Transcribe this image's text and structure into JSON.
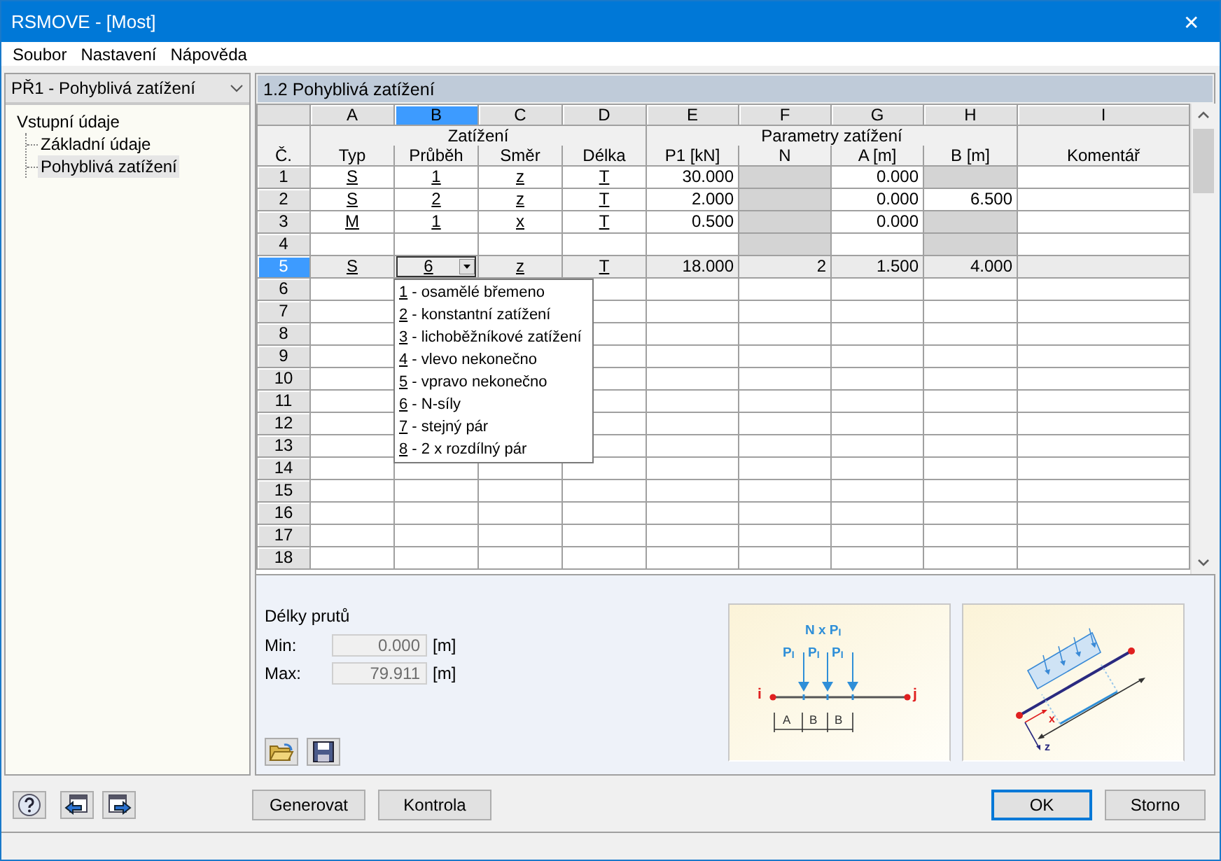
{
  "window": {
    "title": "RSMOVE - [Most]",
    "close": "✕"
  },
  "menu": [
    {
      "label": "Soubor"
    },
    {
      "label": "Nastavení"
    },
    {
      "label": "Nápověda"
    }
  ],
  "sidebar": {
    "case_select": "PŘ1 - Pohyblivá zatížení",
    "tree": [
      {
        "label": "Vstupní údaje",
        "selected": false,
        "children": [
          {
            "label": "Základní údaje",
            "selected": false
          },
          {
            "label": "Pohyblivá zatížení",
            "selected": true
          }
        ]
      }
    ]
  },
  "panel": {
    "title": "1.2 Pohyblivá zatížení",
    "table": {
      "number_header": "Č.",
      "columns": [
        {
          "letter": "A",
          "selected": false,
          "kind": "choice"
        },
        {
          "letter": "B",
          "selected": true,
          "kind": "choice"
        },
        {
          "letter": "C",
          "selected": false,
          "kind": "choice"
        },
        {
          "letter": "D",
          "selected": false,
          "kind": "choice"
        },
        {
          "letter": "E",
          "selected": false,
          "kind": "number"
        },
        {
          "letter": "F",
          "selected": false,
          "kind": "number"
        },
        {
          "letter": "G",
          "selected": false,
          "kind": "number"
        },
        {
          "letter": "H",
          "selected": false,
          "kind": "number"
        },
        {
          "letter": "I",
          "selected": false,
          "kind": "text"
        }
      ],
      "groups": [
        "Zatížení",
        "Parametry zatížení"
      ],
      "names": [
        "Typ",
        "Průběh",
        "Směr",
        "Délka",
        "P1 [kN]",
        "N",
        "A [m]",
        "B [m]",
        "Komentář"
      ],
      "rows": [
        {
          "number": "1",
          "selected": false,
          "cells": [
            {
              "value": "S",
              "disabled": false
            },
            {
              "value": "1",
              "disabled": false
            },
            {
              "value": "z",
              "disabled": false
            },
            {
              "value": "T",
              "disabled": false
            },
            {
              "value": "30.000",
              "disabled": false
            },
            {
              "disabled": true
            },
            {
              "value": "0.000",
              "disabled": false
            },
            {
              "disabled": true
            },
            {
              "disabled": false
            }
          ]
        },
        {
          "number": "2",
          "selected": false,
          "cells": [
            {
              "value": "S",
              "disabled": false
            },
            {
              "value": "2",
              "disabled": false
            },
            {
              "value": "z",
              "disabled": false
            },
            {
              "value": "T",
              "disabled": false
            },
            {
              "value": "2.000",
              "disabled": false
            },
            {
              "disabled": true
            },
            {
              "value": "0.000",
              "disabled": false
            },
            {
              "value": "6.500",
              "disabled": false
            },
            {
              "disabled": false
            }
          ]
        },
        {
          "number": "3",
          "selected": false,
          "cells": [
            {
              "value": "M",
              "disabled": false
            },
            {
              "value": "1",
              "disabled": false
            },
            {
              "value": "x",
              "disabled": false
            },
            {
              "value": "T",
              "disabled": false
            },
            {
              "value": "0.500",
              "disabled": false
            },
            {
              "disabled": true
            },
            {
              "value": "0.000",
              "disabled": false
            },
            {
              "disabled": true
            },
            {
              "disabled": false
            }
          ]
        },
        {
          "number": "4",
          "selected": false,
          "cells": [
            {
              "disabled": false
            },
            {
              "disabled": false
            },
            {
              "disabled": false
            },
            {
              "disabled": false
            },
            {
              "disabled": false
            },
            {
              "disabled": true
            },
            {
              "disabled": false
            },
            {
              "disabled": true
            },
            {
              "disabled": false
            }
          ]
        },
        {
          "number": "5",
          "selected": true,
          "cells": [
            {
              "value": "S",
              "disabled": false
            },
            {
              "value": "6",
              "disabled": false,
              "kind": "combo",
              "options": [
                {
                  "key": "1",
                  "text": " - osamělé břemeno"
                },
                {
                  "key": "2",
                  "text": " - konstantní zatížení"
                },
                {
                  "key": "3",
                  "text": " - lichoběžníkové zatížení"
                },
                {
                  "key": "4",
                  "text": " - vlevo nekonečno"
                },
                {
                  "key": "5",
                  "text": " - vpravo nekonečno"
                },
                {
                  "key": "6",
                  "text": " - N-síly"
                },
                {
                  "key": "7",
                  "text": " - stejný pár"
                },
                {
                  "key": "8",
                  "text": " - 2 x rozdílný pár"
                }
              ]
            },
            {
              "value": "z",
              "disabled": false
            },
            {
              "value": "T",
              "disabled": false
            },
            {
              "value": "18.000",
              "disabled": false
            },
            {
              "value": "2",
              "disabled": false
            },
            {
              "value": "1.500",
              "disabled": false
            },
            {
              "value": "4.000",
              "disabled": false
            },
            {
              "disabled": false
            }
          ]
        },
        {
          "number": "6",
          "selected": false
        },
        {
          "number": "7",
          "selected": false
        },
        {
          "number": "8",
          "selected": false
        },
        {
          "number": "9",
          "selected": false
        },
        {
          "number": "10",
          "selected": false
        },
        {
          "number": "11",
          "selected": false
        },
        {
          "number": "12",
          "selected": false
        },
        {
          "number": "13",
          "selected": false
        },
        {
          "number": "14",
          "selected": false
        },
        {
          "number": "15",
          "selected": false
        },
        {
          "number": "16",
          "selected": false
        },
        {
          "number": "17",
          "selected": false
        },
        {
          "number": "18",
          "selected": false
        }
      ]
    },
    "lengths": {
      "title": "Délky prutů",
      "fields": [
        {
          "label": "Min:",
          "value": "0.000",
          "unit": "[m]",
          "disabled": true
        },
        {
          "label": "Max:",
          "value": "79.911",
          "unit": "[m]",
          "disabled": true
        }
      ]
    },
    "diagrams": [
      {
        "kind": "point-loads",
        "labels": [
          "N x P$_{I}$",
          "P$_{I}$",
          "P$_{I}$",
          "P$_{I}$",
          "i",
          "j",
          "A",
          "B",
          "B"
        ]
      },
      {
        "kind": "inclined-load",
        "labels": [
          "x",
          "z"
        ]
      }
    ]
  },
  "footer": {
    "buttons": [
      {
        "label": "Generovat",
        "kind": "tool",
        "focused": false
      },
      {
        "label": "Kontrola",
        "kind": "tool",
        "focused": false
      },
      {
        "label": "OK",
        "kind": "dialog",
        "focused": true
      },
      {
        "label": "Storno",
        "kind": "dialog",
        "focused": false
      }
    ]
  }
}
